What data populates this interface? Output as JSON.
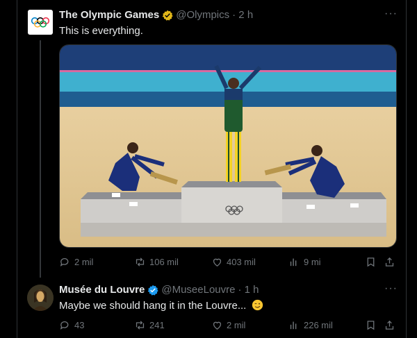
{
  "tweet1": {
    "name": "The Olympic Games",
    "handle": "@Olympics",
    "time": "· 2 h",
    "text": "This is everything.",
    "more": "···",
    "actions": {
      "replies": "2 mil",
      "reposts": "106 mil",
      "likes": "403 mil",
      "views": "9 mi"
    }
  },
  "tweet2": {
    "name": "Musée du Louvre",
    "handle": "@MuseeLouvre",
    "time": "· 1 h",
    "text": "Maybe we should hang it in the Louvre...",
    "more": "···",
    "actions": {
      "replies": "43",
      "reposts": "241",
      "likes": "2 mil",
      "views": "226 mil"
    }
  },
  "colors": {
    "background": "#000000",
    "text": "#e7e9ea",
    "muted": "#71767b",
    "verified_gold": "#e2b719",
    "verified_blue": "#1d9bf0"
  },
  "icons": {
    "reply": "reply-icon",
    "repost": "repost-icon",
    "like": "heart-icon",
    "views": "views-icon",
    "bookmark": "bookmark-icon",
    "share": "share-icon"
  }
}
